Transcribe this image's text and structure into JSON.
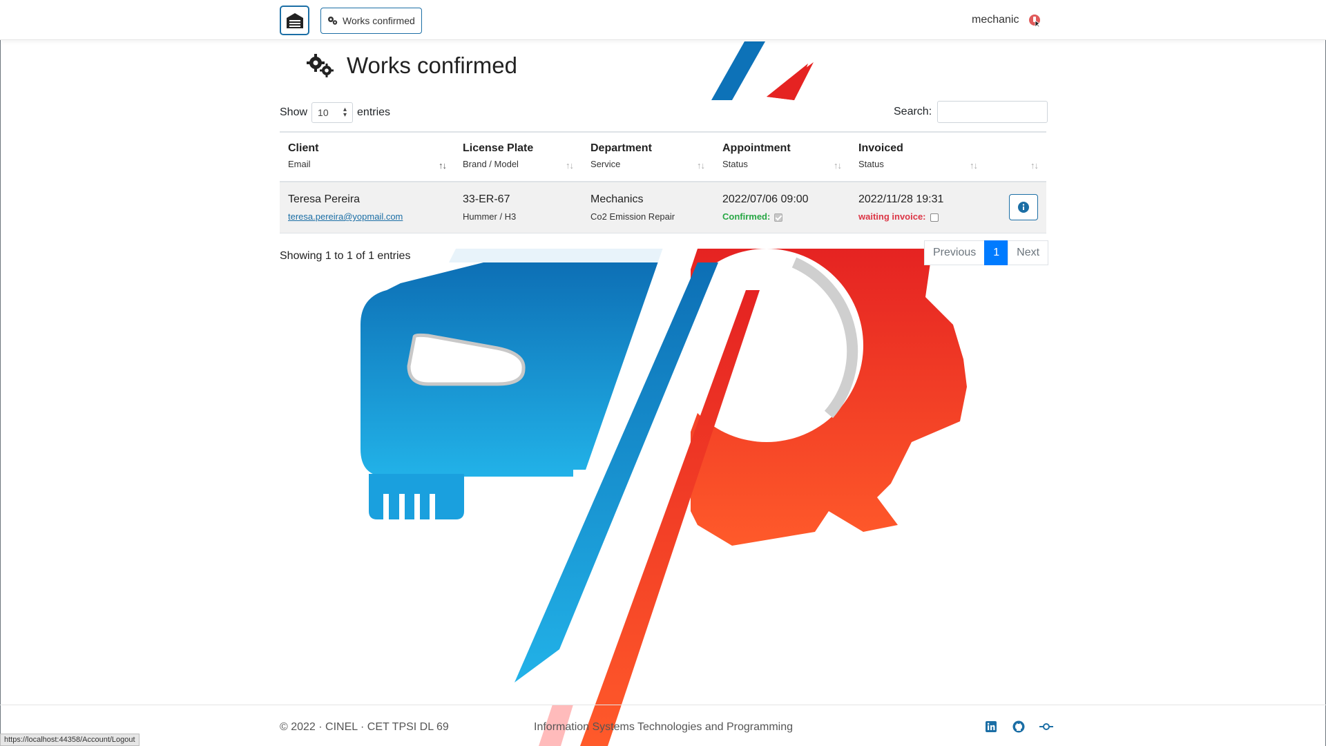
{
  "navbar": {
    "nav_pill_label": "Works confirmed",
    "username": "mechanic"
  },
  "page": {
    "title": "Works confirmed"
  },
  "controls": {
    "show_label": "Show",
    "page_length": "10",
    "entries_label": "entries",
    "search_label": "Search:",
    "search_value": ""
  },
  "table": {
    "columns": [
      {
        "main": "Client",
        "sub": "Email"
      },
      {
        "main": "License Plate",
        "sub": "Brand / Model"
      },
      {
        "main": "Department",
        "sub": "Service"
      },
      {
        "main": "Appointment",
        "sub": "Status"
      },
      {
        "main": "Invoiced",
        "sub": "Status"
      }
    ],
    "rows": [
      {
        "client": "Teresa Pereira",
        "email": "teresa.pereira@yopmail.com",
        "plate": "33-ER-67",
        "brand_model": "Hummer / H3",
        "department": "Mechanics",
        "service": "Co2 Emission Repair",
        "appointment": "2022/07/06 09:00",
        "appointment_status": "Confirmed:",
        "appointment_checked": true,
        "invoiced": "2022/11/28 19:31",
        "invoice_status": "waiting invoice:",
        "invoice_checked": false
      }
    ]
  },
  "info_text": "Showing 1 to 1 of 1 entries",
  "pagination": {
    "previous": "Previous",
    "current": "1",
    "next": "Next"
  },
  "footer": {
    "left": "© 2022 · CINEL · CET TPSI DL 69",
    "middle": "Information Systems Technologies and Programming",
    "icons": [
      "linkedin-icon",
      "github-icon",
      "git-commit-icon"
    ]
  },
  "statusbar": {
    "url": "https://localhost:44358/Account/Logout"
  },
  "colors": {
    "primary": "#007bff",
    "accent_blue": "#1b6ea5",
    "success": "#28a745",
    "danger": "#dc3545",
    "logo_blue": "#1a8fd6",
    "logo_red": "#f0452a"
  }
}
